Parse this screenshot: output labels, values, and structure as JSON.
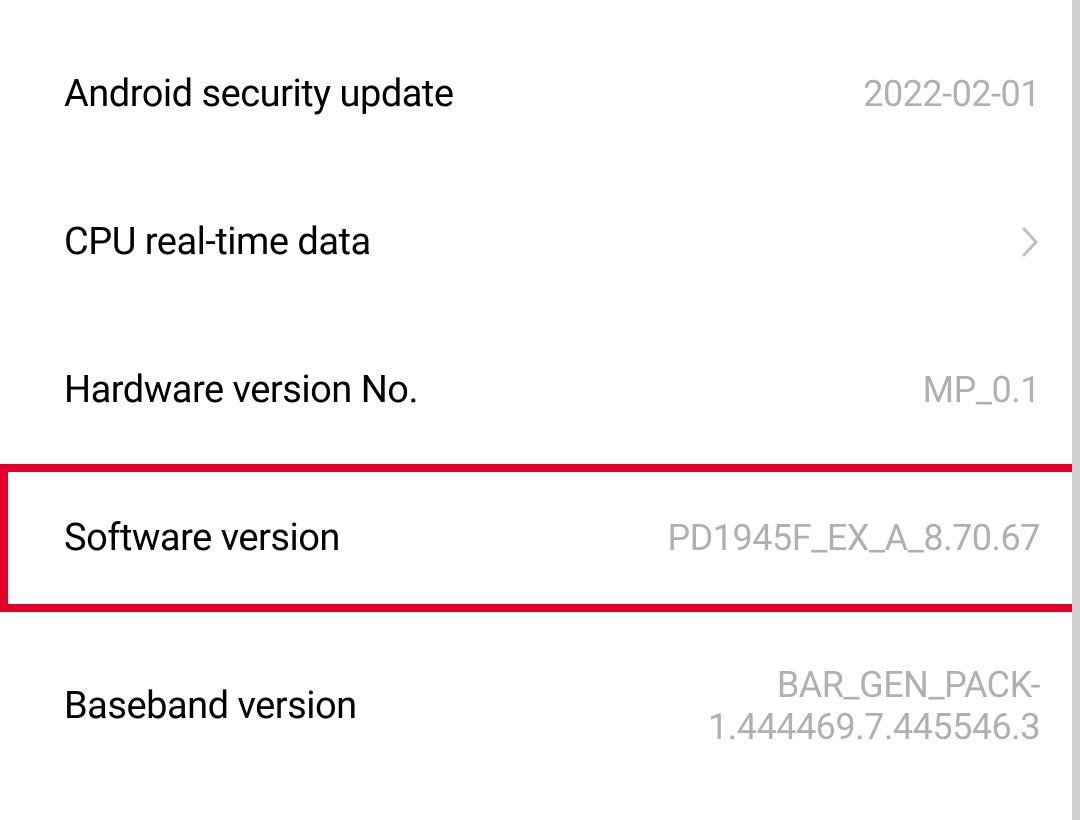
{
  "settings": {
    "android_security_update": {
      "label": "Android security update",
      "value": "2022-02-01"
    },
    "cpu_realtime_data": {
      "label": "CPU real-time data"
    },
    "hardware_version_no": {
      "label": "Hardware version No.",
      "value": "MP_0.1"
    },
    "software_version": {
      "label": "Software version",
      "value": "PD1945F_EX_A_8.70.67"
    },
    "baseband_version": {
      "label": "Baseband version",
      "value": "BAR_GEN_PACK-1.444469.7.445546.3"
    }
  }
}
